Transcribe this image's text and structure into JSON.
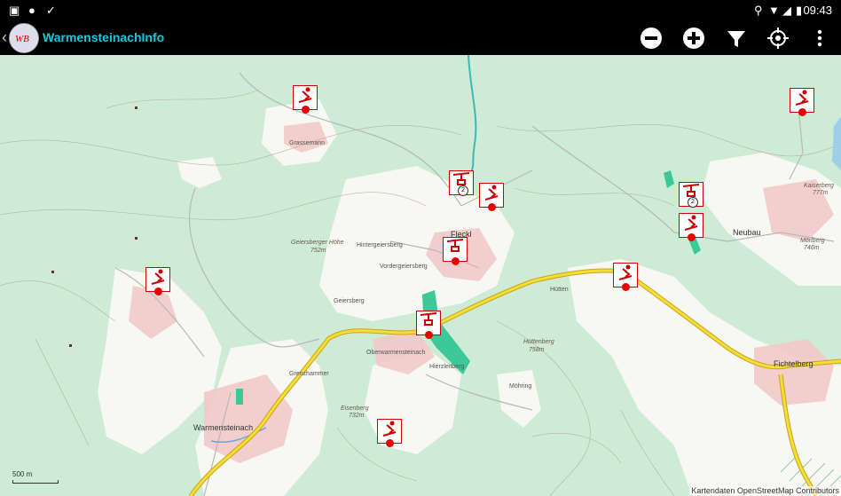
{
  "status_bar": {
    "time": "09:43"
  },
  "app_bar": {
    "title": "WarmensteinachInfo"
  },
  "map": {
    "labels": {
      "grassemann": "Grassemann",
      "geiersberger_hoehe": "Geiersberger Höhe",
      "geiersberger_hoehe_elev": "752m",
      "hintergeiersberg": "Hintergeiersberg",
      "vordergeiersberg": "Vordergeiersberg",
      "fleckl": "Fleckl",
      "geiersberg": "Geiersberg",
      "oberwarmensteinach": "Oberwarmensteinach",
      "hierzleitberg": "Hierzleitberg",
      "huettenberg": "Hüttenberg",
      "huettenberg_elev": "758m",
      "moehring": "Möhring",
      "eisenberg": "Eisenberg",
      "eisenberg_elev": "732m",
      "warmensteinach": "Warmensteinach",
      "grenzhammer": "Grenzhammer",
      "neubau": "Neubau",
      "kaiserberg": "Kaiserberg",
      "kaiserberg_elev": "777m",
      "moerlberg": "Mörlberg",
      "moerlberg_elev": "746m",
      "fichtelberg": "Fichtelberg",
      "huettstadl": "Hütten",
      "scale": "500 m",
      "attribution": "Kartendaten OpenStreetMap Contributors"
    },
    "markers": [
      {
        "name": "ski-marker-grassemann"
      },
      {
        "name": "ski-marker-top-right"
      },
      {
        "name": "ski-marker-fleckl-1",
        "badge": "2"
      },
      {
        "name": "ski-marker-fleckl-2"
      },
      {
        "name": "ski-marker-neubau-1",
        "badge": "2"
      },
      {
        "name": "ski-marker-neubau-2"
      },
      {
        "name": "ski-marker-fleckl-3"
      },
      {
        "name": "ski-marker-west"
      },
      {
        "name": "ski-marker-geiersberg"
      },
      {
        "name": "ski-marker-oberwarmensteinach"
      },
      {
        "name": "ski-marker-south"
      }
    ]
  },
  "colors": {
    "map_base": "#cdebd5",
    "road_major": "#f5dd37",
    "marker_red": "#e60000",
    "app_bar": "#000000"
  }
}
